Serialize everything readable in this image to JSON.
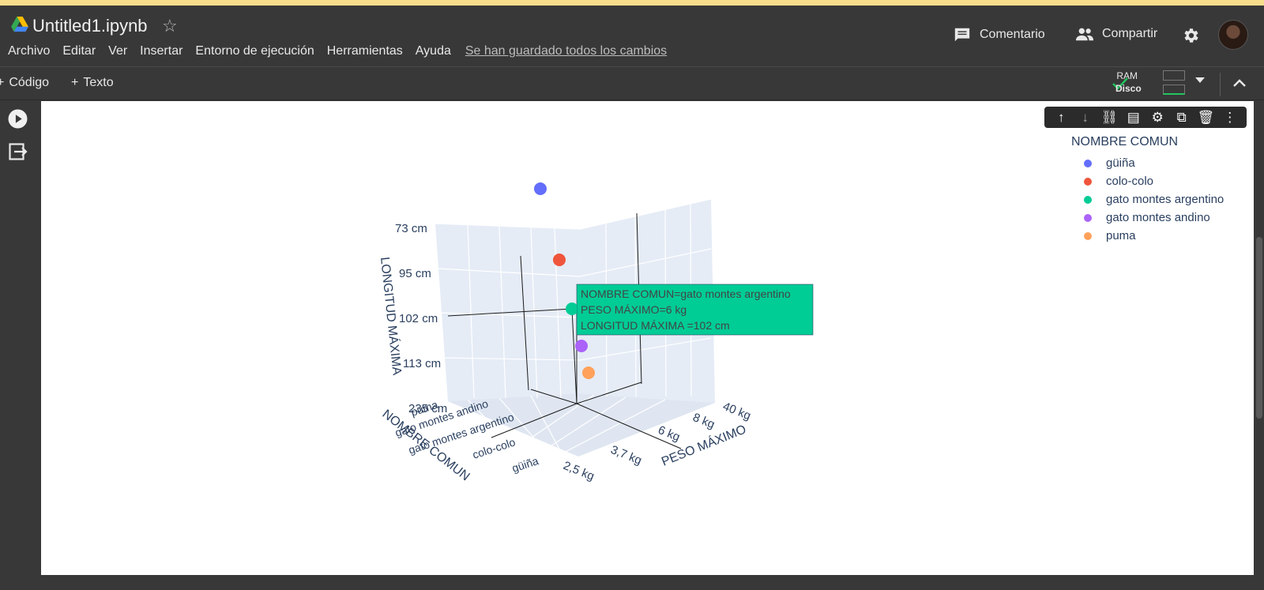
{
  "header": {
    "title": "Untitled1.ipynb",
    "menu": [
      "Archivo",
      "Editar",
      "Ver",
      "Insertar",
      "Entorno de ejecución",
      "Herramientas",
      "Ayuda"
    ],
    "saved_status": "Se han guardado todos los cambios",
    "comment_label": "Comentario",
    "share_label": "Compartir"
  },
  "toolbar": {
    "add_code": "Código",
    "add_text": "Texto",
    "ram_label": "RAM",
    "disk_label": "Disco"
  },
  "colors": {
    "guina": "#636efa",
    "colocolo": "#ef553b",
    "gato_argentino": "#00cc96",
    "gato_andino": "#ab63fa",
    "puma": "#ffa15a",
    "scene_bg": "#e5ecf6",
    "text": "#2a3f5f"
  },
  "chart_data": {
    "type": "scatter",
    "scatter_kind": "3d",
    "legend_title": "NOMBRE COMUN",
    "legend_placement": "top-right",
    "x_axis": {
      "title": "PESO MÁXIMO",
      "ticks": [
        "2,5 kg",
        "3,7 kg",
        "6 kg",
        "8 kg",
        "40 kg"
      ]
    },
    "y_axis": {
      "title": "NOMBRE COMUN",
      "ticks": [
        "güiña",
        "colo-colo",
        "gato montes argentino",
        "gato montes andino",
        "puma"
      ]
    },
    "z_axis": {
      "title": "LONGITUD MÁXIMA",
      "ticks": [
        "73 cm",
        "95 cm",
        "102 cm",
        "113 cm",
        "235 cm"
      ]
    },
    "series": [
      {
        "name": "güiña",
        "x": "2,5 kg",
        "y": "güiña",
        "z": "73 cm"
      },
      {
        "name": "colo-colo",
        "x": "3,7 kg",
        "y": "colo-colo",
        "z": "95 cm"
      },
      {
        "name": "gato montes argentino",
        "x": "6 kg",
        "y": "gato montes argentino",
        "z": "102 cm"
      },
      {
        "name": "gato montes andino",
        "x": "8 kg",
        "y": "gato montes andino",
        "z": "113 cm"
      },
      {
        "name": "puma",
        "x": "40 kg",
        "y": "puma",
        "z": "235 cm"
      }
    ],
    "hover": {
      "line1": "NOMBRE COMUN=gato montes argentino",
      "line2": "PESO MÁXIMO=6 kg",
      "line3": "LONGITUD MÁXIMA =102 cm"
    }
  }
}
